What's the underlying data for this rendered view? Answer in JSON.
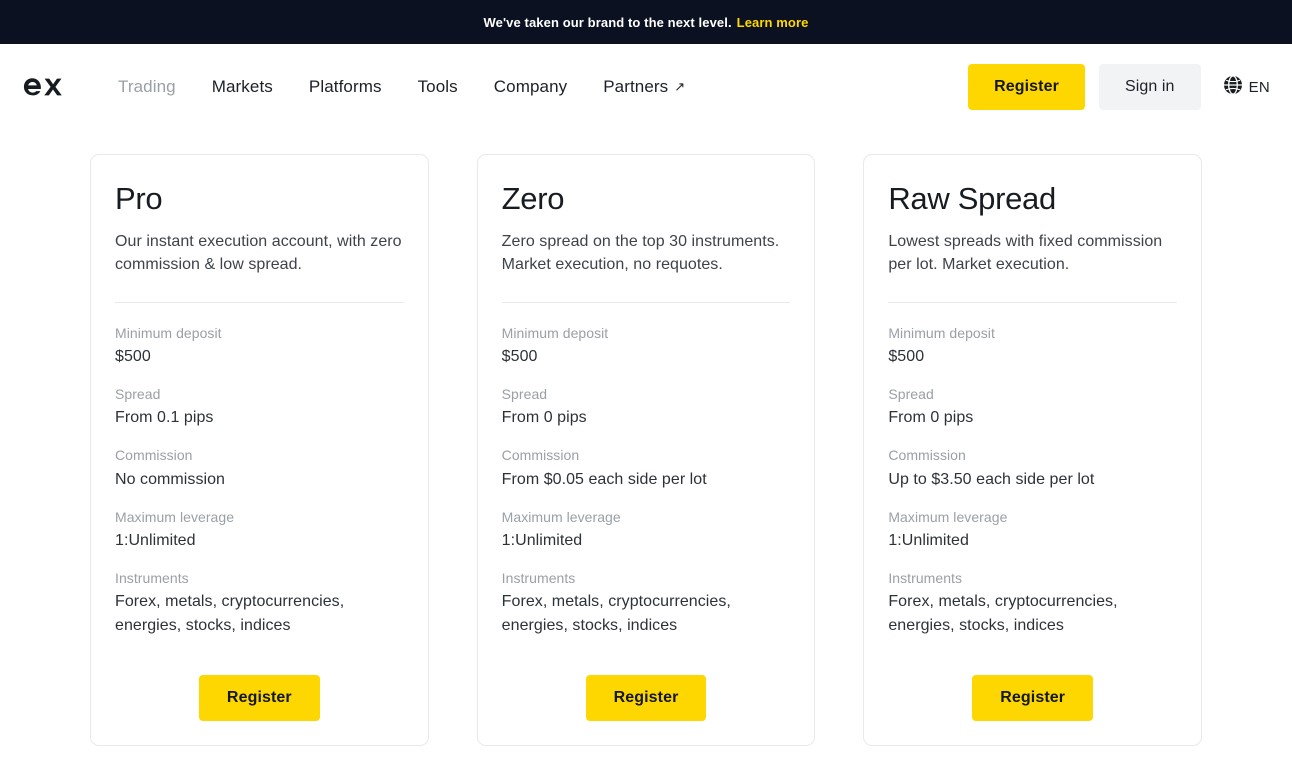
{
  "announcement": {
    "text": "We've taken our brand to the next level.",
    "link_label": "Learn more",
    "background_color": "#0b1120",
    "link_color": "#ffd900"
  },
  "header": {
    "logo_text": "ex",
    "nav": [
      {
        "label": "Trading",
        "muted": true,
        "external": false
      },
      {
        "label": "Markets",
        "muted": false,
        "external": false
      },
      {
        "label": "Platforms",
        "muted": false,
        "external": false
      },
      {
        "label": "Tools",
        "muted": false,
        "external": false
      },
      {
        "label": "Company",
        "muted": false,
        "external": false
      },
      {
        "label": "Partners",
        "muted": false,
        "external": true
      }
    ],
    "register_label": "Register",
    "signin_label": "Sign in",
    "language_label": "EN",
    "language_icon": "globe-icon",
    "external_link_icon": "arrow-up-right-icon",
    "accent_color": "#ffd700",
    "signin_background": "#f2f3f5"
  },
  "cards": [
    {
      "title": "Pro",
      "description": "Our instant execution account, with zero commission & low spread.",
      "specs": [
        {
          "label": "Minimum deposit",
          "value": "$500"
        },
        {
          "label": "Spread",
          "value": "From 0.1 pips"
        },
        {
          "label": "Commission",
          "value": "No commission"
        },
        {
          "label": "Maximum leverage",
          "value": "1:Unlimited"
        },
        {
          "label": "Instruments",
          "value": "Forex, metals, cryptocurrencies, energies, stocks, indices"
        }
      ],
      "cta_label": "Register"
    },
    {
      "title": "Zero",
      "description": "Zero spread on the top 30 instruments. Market execution, no requotes.",
      "specs": [
        {
          "label": "Minimum deposit",
          "value": "$500"
        },
        {
          "label": "Spread",
          "value": "From 0 pips"
        },
        {
          "label": "Commission",
          "value": "From $0.05 each side per lot"
        },
        {
          "label": "Maximum leverage",
          "value": "1:Unlimited"
        },
        {
          "label": "Instruments",
          "value": "Forex, metals, cryptocurrencies, energies, stocks, indices"
        }
      ],
      "cta_label": "Register"
    },
    {
      "title": "Raw Spread",
      "description": "Lowest spreads with fixed commission per lot. Market execution.",
      "specs": [
        {
          "label": "Minimum deposit",
          "value": "$500"
        },
        {
          "label": "Spread",
          "value": "From 0 pips"
        },
        {
          "label": "Commission",
          "value": "Up to $3.50 each side per lot"
        },
        {
          "label": "Maximum leverage",
          "value": "1:Unlimited"
        },
        {
          "label": "Instruments",
          "value": "Forex, metals, cryptocurrencies, energies, stocks, indices"
        }
      ],
      "cta_label": "Register"
    }
  ]
}
